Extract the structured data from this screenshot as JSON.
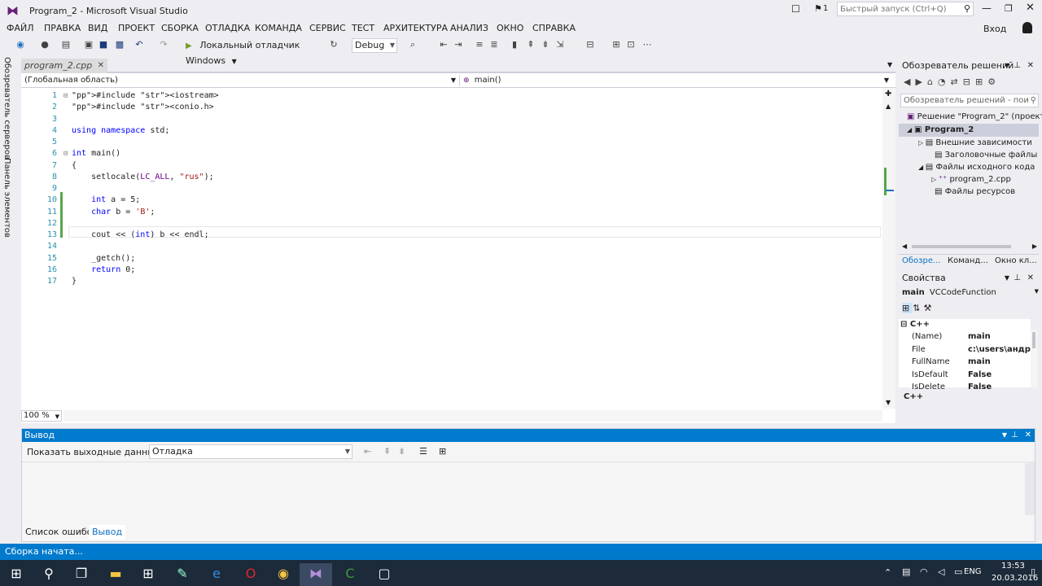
{
  "window": {
    "title": "Program_2 - Microsoft Visual Studio",
    "quick_launch_placeholder": "Быстрый запуск (Ctrl+Q)",
    "signin": "Вход",
    "notification_count": "1"
  },
  "menu": [
    "ФАЙЛ",
    "ПРАВКА",
    "ВИД",
    "ПРОЕКТ",
    "СБОРКА",
    "ОТЛАДКА",
    "КОМАНДА",
    "СЕРВИС",
    "ТЕСТ",
    "АРХИТЕКТУРА",
    "АНАЛИЗ",
    "ОКНО",
    "СПРАВКА"
  ],
  "toolbar": {
    "debugger_label": "Локальный отладчик Windows",
    "config": "Debug"
  },
  "left_rail": {
    "server_explorer": "Обозреватель серверов",
    "toolbox": "Панель элементов"
  },
  "editor": {
    "tab": "program_2.cpp",
    "scope": "(Глобальная область)",
    "function": "main()",
    "zoom": "100 %",
    "lines": [
      {
        "n": "1",
        "text": "#include <iostream>"
      },
      {
        "n": "2",
        "text": "#include <conio.h>"
      },
      {
        "n": "3",
        "text": ""
      },
      {
        "n": "4",
        "text": "using namespace std;"
      },
      {
        "n": "5",
        "text": ""
      },
      {
        "n": "6",
        "text": "int main()"
      },
      {
        "n": "7",
        "text": "{"
      },
      {
        "n": "8",
        "text": "    setlocale(LC_ALL, \"rus\");"
      },
      {
        "n": "9",
        "text": ""
      },
      {
        "n": "10",
        "text": "    int a = 5;"
      },
      {
        "n": "11",
        "text": "    char b = 'B';"
      },
      {
        "n": "12",
        "text": ""
      },
      {
        "n": "13",
        "text": "    cout << (int) b << endl;"
      },
      {
        "n": "14",
        "text": ""
      },
      {
        "n": "15",
        "text": "    _getch();"
      },
      {
        "n": "16",
        "text": "    return 0;"
      },
      {
        "n": "17",
        "text": "}"
      }
    ]
  },
  "solution_explorer": {
    "title": "Обозреватель решений",
    "search": "Обозреватель решений - пои",
    "tree": [
      "Решение \"Program_2\" (проекто",
      "Program_2",
      "Внешние зависимости",
      "Заголовочные файлы",
      "Файлы исходного кода",
      "program_2.cpp",
      "Файлы ресурсов"
    ],
    "tabs": [
      "Обозре...",
      "Команд...",
      "Окно кл..."
    ]
  },
  "properties": {
    "title": "Свойства",
    "object": "main",
    "object_type": "VCCodeFunction",
    "category": "C++",
    "rows": [
      {
        "name": "(Name)",
        "value": "main"
      },
      {
        "name": "File",
        "value": "c:\\users\\андре"
      },
      {
        "name": "FullName",
        "value": "main"
      },
      {
        "name": "IsDefault",
        "value": "False"
      },
      {
        "name": "IsDelete",
        "value": "False"
      }
    ],
    "footer": "C++"
  },
  "output": {
    "title": "Вывод",
    "show_from_label": "Показать выходные данные от:",
    "source": "Отладка",
    "tabs": [
      "Список ошибок",
      "Вывод"
    ]
  },
  "status": "Сборка начата...",
  "taskbar": {
    "time": "13:53",
    "date": "20.03.2016",
    "lang": "ENG"
  }
}
